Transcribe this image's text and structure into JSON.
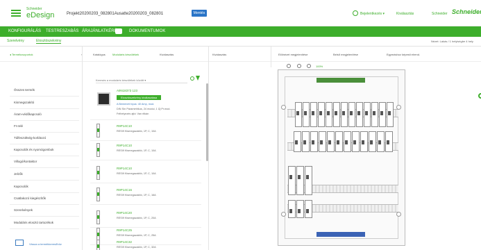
{
  "header": {
    "brand_small": "Schneider",
    "brand_big": "eDesign",
    "project": "Projekt20200203_082801Ausatte20200203_082801",
    "save_button": "Mentés",
    "user": "Bejelentkezés ▾",
    "link": "Kiválasztás",
    "logo_small": "Schneider",
    "logo_big": "Schneider"
  },
  "nav": {
    "items": [
      "Konfigurálás",
      "Testreszabás",
      "Árajánlatkérés",
      "Dokumentumok"
    ]
  },
  "subnav": {
    "items": [
      "Szerelvény",
      "Elosztószekrény"
    ],
    "right": "Nézet: Lakás / 1 helyiségbe 4 hely"
  },
  "breadcrumb": {
    "back": "◂ Termékcsoportok",
    "items": [
      "Katalógus",
      "Moduláris készülékek",
      "Kiválasztás"
    ],
    "section": "Kiválasztás"
  },
  "views": {
    "tabs": [
      "Elölnézet megjelenítése",
      "Belső megjelenítése",
      "Egymáshoz képesti elrend."
    ],
    "zoom": "100%"
  },
  "categories": [
    "Összes termék",
    "Kismegszakító",
    "Áram-védőkapcsoló",
    "FI-relé",
    "Túlfeszültség-korlátozó",
    "Kapcsolók és nyomógombok",
    "Villogó/kontaktor",
    "Jelzők",
    "Kapcsolók",
    "Csatlakozó kiegészítők",
    "Szerelvények",
    "Moduláris elosztó tartozékok"
  ],
  "category_bottom": "Vissza a termékkeresőhöz",
  "search": {
    "placeholder": "Keresés a moduláris készülékek között ▾"
  },
  "products": {
    "first": {
      "title": "A9N18373 123",
      "button": "Elosztószekrény kiválasztása",
      "d1": "A Bemeneti típus: 40 Amp, mod.",
      "d2": "DIN Sín Parametrikus, 24 modul, 1 Új Pr.mod.",
      "d3": "Felhelyezés ajtó: Van ritkán"
    },
    "items": [
      {
        "code": "R9P14C10",
        "desc": "RESI9 Kismegszakító, 1P, C, 10A"
      },
      {
        "code": "R9P14C10",
        "desc": "RESI9 Kismegszakító, 1P, C, 10A"
      },
      {
        "code": "R9P14C10",
        "desc": "RESI9 Kismegszakító, 1P, C, 10A"
      },
      {
        "code": "R9P14C16",
        "desc": "RESI9 Kismegszakító, 1P, C, 16A"
      },
      {
        "code": "R9P14C20",
        "desc": "RESI9 Kismegszakító, 1P, C, 20A"
      },
      {
        "code": "R9P14C25",
        "desc": "RESI9 Kismegszakító, 1P, C, 25A"
      },
      {
        "code": "R9P14C32",
        "desc": "RESI9 Kismegszakító, 1P, C, 32A"
      }
    ]
  },
  "colors": {
    "accent": "#3dae2b",
    "save": "#2a75c7",
    "terminal_green": "#4a8f3a",
    "terminal_blue": "#3b63b5"
  }
}
